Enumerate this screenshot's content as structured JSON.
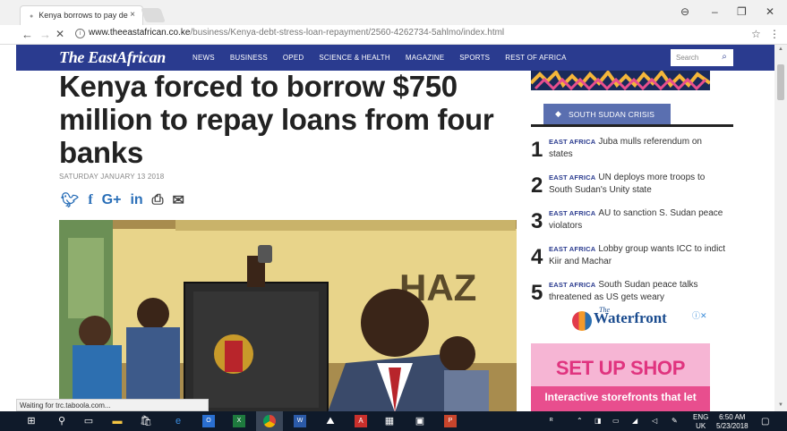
{
  "browser": {
    "tab_title": "Kenya borrows to pay de",
    "tab_close": "×",
    "url_host": "www.theeastafrican.co.ke",
    "url_path": "/business/Kenya-debt-stress-loan-repayment/2560-4262734-5ahlmo/index.html",
    "status_text": "Waiting for trc.taboola.com..."
  },
  "site": {
    "logo": "The EastAfrican",
    "menu": [
      "NEWS",
      "BUSINESS",
      "OPED",
      "SCIENCE & HEALTH",
      "MAGAZINE",
      "SPORTS",
      "REST OF AFRICA"
    ],
    "search_placeholder": "Search"
  },
  "article": {
    "headline": "Kenya forced to borrow $750 million to repay loans from four banks",
    "date": "SATURDAY JANUARY 13 2018"
  },
  "sidebar": {
    "section_label": "SOUTH SUDAN CRISIS",
    "items": [
      {
        "num": "1",
        "kicker": "EAST AFRICA",
        "text": "Juba mulls referendum on states"
      },
      {
        "num": "2",
        "kicker": "EAST AFRICA",
        "text": "UN deploys more troops to South Sudan's Unity state"
      },
      {
        "num": "3",
        "kicker": "EAST AFRICA",
        "text": "AU to sanction S. Sudan peace violators"
      },
      {
        "num": "4",
        "kicker": "EAST AFRICA",
        "text": "Lobby group wants ICC to indict Kiir and Machar"
      },
      {
        "num": "5",
        "kicker": "EAST AFRICA",
        "text": "South Sudan peace talks threatened as US gets weary"
      }
    ]
  },
  "ad": {
    "brand_small": "The",
    "brand": "Waterfront",
    "choice": "ⓘ✕",
    "headline": "SET UP SHOP",
    "subline": "Interactive storefronts that let"
  },
  "taskbar": {
    "lang_top": "ENG",
    "lang_bottom": "UK",
    "time": "6:50 AM",
    "date": "5/23/2018"
  },
  "colors": {
    "nav": "#2a3b8f",
    "crisis": "#5a6fb0",
    "ad_pink": "#e0347f"
  }
}
